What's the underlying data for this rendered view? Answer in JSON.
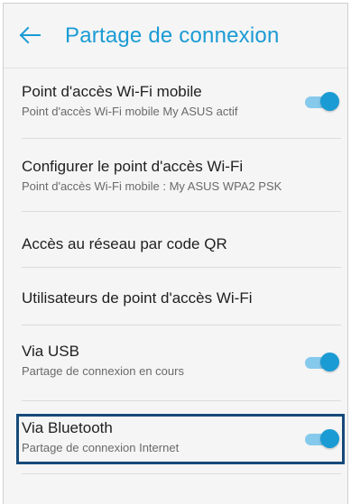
{
  "header": {
    "title": "Partage de connexion"
  },
  "settings": [
    {
      "title": "Point d'accès Wi-Fi mobile",
      "subtitle": "Point d'accès Wi-Fi mobile My ASUS actif",
      "toggle_on": true
    },
    {
      "title": "Configurer le point d'accès Wi-Fi",
      "subtitle": "Point d'accès Wi-Fi mobile : My ASUS WPA2 PSK"
    },
    {
      "title": "Accès au réseau par code QR"
    },
    {
      "title": "Utilisateurs de point d'accès Wi-Fi"
    },
    {
      "title": "Via USB",
      "subtitle": "Partage de connexion en cours",
      "toggle_on": true
    },
    {
      "title": "Via Bluetooth",
      "subtitle": "Partage de connexion Internet",
      "toggle_on": true
    }
  ],
  "colors": {
    "accent": "#1a9bd4",
    "toggle_track": "#85c9ec",
    "highlight_border": "#164a7a"
  },
  "icons": {
    "back": "arrow-left-icon"
  }
}
